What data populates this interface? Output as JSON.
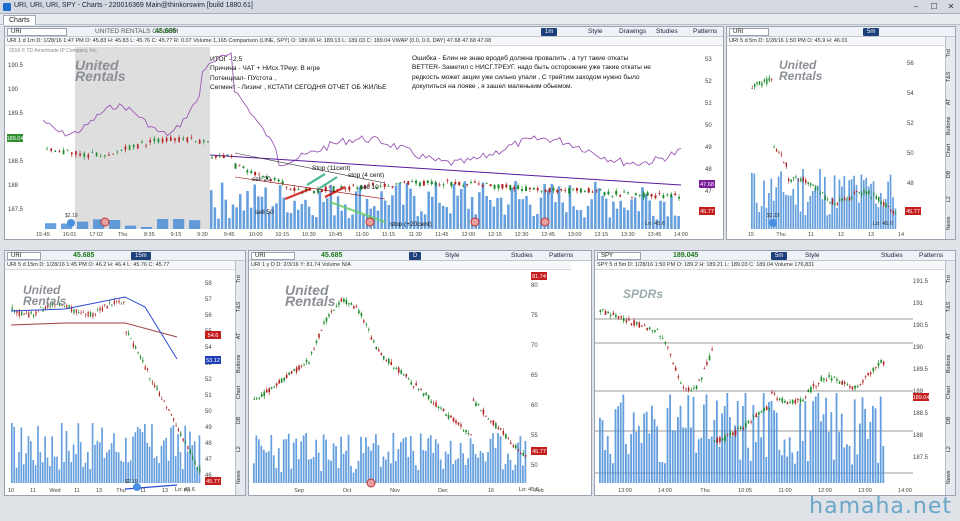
{
  "window": {
    "title": "URI, URI, URI, SPY - Charts - 220016369 Main@thinkorswim [build 1880.61]",
    "tab": "Charts"
  },
  "main": {
    "symbol": "URI",
    "price": "45.685",
    "name": "UNITED RENTALS CV COM",
    "timeframe": "1m",
    "info": "URI 1 d 1m  D: 1/28/16 1:47 PM  O: 45.83  H: 45.83  L: 45.76  C: 45.77  R: 0.07  Volume  1,165  Comparison (LINE, SPY)  O: 189.06  H: 189.13  L: 189.03  C: 189.04  VWAP (0.0, 0.0, DAY)  47.68  47.68  47.68",
    "copyright": "2016 © TD Ameritrade IP Company, Inc.",
    "x_ticks": [
      "15:45",
      "16:01",
      "17:02",
      "Thu",
      "8:35",
      "9:15",
      "9:30",
      "9:45",
      "10:00",
      "10:15",
      "10:30",
      "10:45",
      "11:00",
      "11:15",
      "11:30",
      "11:45",
      "12:00",
      "12:15",
      "12:30",
      "12:45",
      "13:00",
      "13:15",
      "13:30",
      "13:45",
      "14:00"
    ],
    "y_ticks": [
      "190.5",
      "190",
      "189.5",
      "189",
      "188.5",
      "188",
      "187.5"
    ],
    "right_ticks": [
      "53",
      "52",
      "51",
      "50",
      "49",
      "48",
      "47",
      "46"
    ],
    "price_flags": {
      "spy": "189.04",
      "vwap": "47.68",
      "last": "45.77",
      "dot": "$2.19",
      "low": "Lo: 45.6"
    },
    "annotations": {
      "sell20": "sell 20",
      "sell50": "sell 50",
      "stop11": "Stop (11cent)",
      "stop4": "stop (4 cent)",
      "sell10": "sell 10",
      "stop20": "stop (+20cent)"
    },
    "notes_left": [
      "ИТОГ - 2,5",
      "Причина - ЧАТ + НИсх.ТРеуг. В игре",
      "Потенциал- ПУстота ,",
      "Сегмент - Лизинг , КСТАТИ СЕГОДНЯ ОТЧЕТ ОБ ЖИЛЬЕ"
    ],
    "notes_right": [
      "Ошибка - Блин не знаю вродеб должна провалить , а тут такие откаты",
      "",
      "BETTER- Заметил с НИСГ.ТРЕУГ. надо быть осторожние уже такие откаты не",
      "редкость  может акции уже сильно упали , С трейтим заходом нужно было",
      "докупиться на лояве , я зашел маленьким обьемом."
    ],
    "toolbar": [
      "Style",
      "Drawings",
      "Studies",
      "Patterns"
    ]
  },
  "side": {
    "symbol": "URI",
    "timeframe": "5m",
    "info": "URI 5 d 5m  D: 1/28/16 1:50 PM  O: 45.9  H: 46.01",
    "x_ticks": [
      "15",
      "Thu",
      "11",
      "12",
      "13",
      "14"
    ],
    "y_ticks": [
      "56",
      "54",
      "52",
      "50",
      "48",
      "46"
    ],
    "flag": "45.77",
    "dot": "$2.19",
    "low": "Lo: 45.6"
  },
  "p1": {
    "symbol": "URI",
    "price": "45.685",
    "timeframe": "15m",
    "info": "URI 5 d 15m  D: 1/28/16 1:45 PM  O: 46.2  H: 46.4  L: 45.76  C: 45.77",
    "x_ticks": [
      "10",
      "11",
      "Wed",
      "11",
      "13",
      "Thu",
      "11",
      "13",
      "Fri"
    ],
    "y_ticks": [
      "58",
      "57",
      "56",
      "55",
      "54",
      "53",
      "52",
      "51",
      "50",
      "49",
      "48",
      "47",
      "46"
    ],
    "flags": {
      "red": "54.6",
      "blue": "53.12",
      "last": "45.77"
    },
    "dot": "$2.19",
    "low": "Lo: 45.6"
  },
  "p2": {
    "symbol": "URI",
    "price": "45.685",
    "timeframe": "D",
    "info": "URI 1 y D  D: 2/3/16  Y: 81.74  Volume  N/A",
    "x_ticks": [
      "Sep",
      "Oct",
      "Nov",
      "Dec",
      "16",
      "Feb"
    ],
    "y_ticks": [
      "80",
      "75",
      "70",
      "65",
      "60",
      "55",
      "50"
    ],
    "flags": {
      "top": "81.74",
      "last": "45.77"
    },
    "dot": "$2.19",
    "low": "Lo: 45.6"
  },
  "p3": {
    "symbol": "SPY",
    "price": "189.045",
    "timeframe": "5m",
    "info": "SPY 5 d 5m  D: 1/28/16 1:50 PM  O: 189.2  H: 189.21  L: 189.03  C: 189.04  Volume  176,831",
    "x_ticks": [
      "13:00",
      "14:00",
      "Thu",
      "10:05",
      "11:00",
      "12:00",
      "13:00",
      "14:00"
    ],
    "y_ticks": [
      "191.5",
      "191",
      "190.5",
      "190",
      "189.5",
      "189",
      "188.5",
      "188",
      "187.5"
    ],
    "flag": "189.04"
  },
  "labels": {
    "style": "Style",
    "studies": "Studies",
    "patterns": "Patterns",
    "drawings": "Drawings"
  },
  "side_tabs": [
    "Trd",
    "T&S",
    "AT",
    "Buttons",
    "Chart",
    "DB",
    "L2",
    "News"
  ],
  "logo": {
    "united": "United",
    "rentals": "Rentals",
    "spdrs": "SPDRs"
  },
  "watermark": "hamaha.net",
  "colors": {
    "up": "#1a8a2a",
    "down": "#b02020",
    "vol": "#4a8ed8",
    "spy_line": "#8e44ad",
    "ma": "#5a1aa0",
    "blue_ma": "#2a4ad0",
    "flag_red": "#c41e1e",
    "flag_blue": "#1e3fb8",
    "flag_purple": "#7a1e9a",
    "flag_green": "#2f8f2f"
  }
}
